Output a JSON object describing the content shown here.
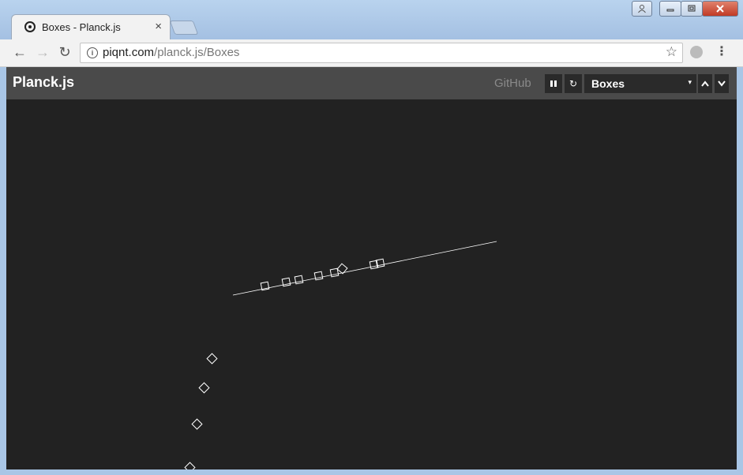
{
  "browser": {
    "tab_title": "Boxes - Planck.js",
    "url_host": "piqnt.com",
    "url_path": "/planck.js/Boxes",
    "close_glyph": "×",
    "back_glyph": "←",
    "forward_glyph": "→",
    "reload_glyph": "↻",
    "star_glyph": "☆",
    "menu_glyph": "⋮",
    "info_glyph": "i"
  },
  "header": {
    "brand": "Planck.js",
    "github_label": "GitHub",
    "pause_glyph": "❚❚",
    "reload_glyph": "↻",
    "selected_example": "Boxes",
    "select_arrow": "▾",
    "up_glyph": "⌃",
    "down_glyph": "⌄"
  },
  "colors": {
    "page_bg": "#222222",
    "header_bg": "#4a4a4a",
    "stroke": "#ffffff"
  }
}
